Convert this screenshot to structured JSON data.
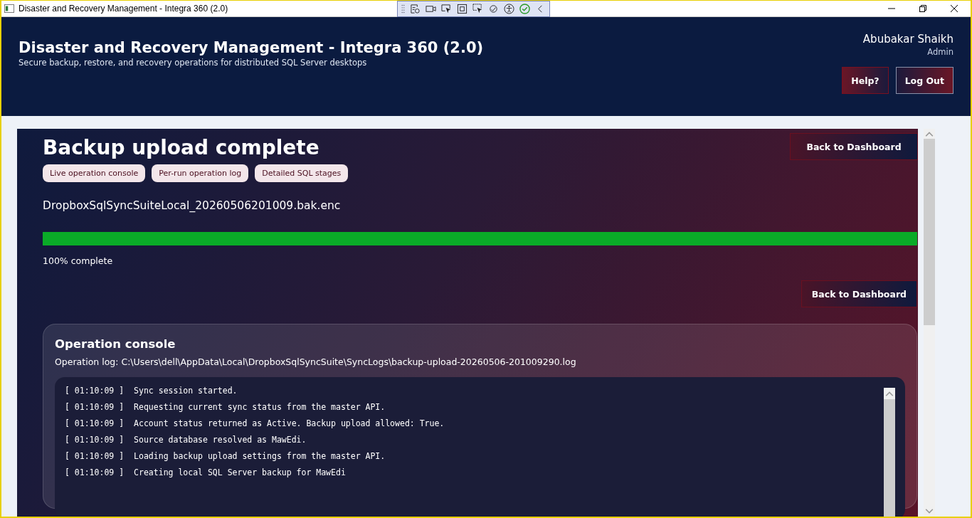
{
  "window": {
    "title": "Disaster and Recovery Management - Integra 360 (2.0)"
  },
  "header": {
    "title": "Disaster and Recovery Management - Integra 360 (2.0)",
    "subtitle": "Secure backup, restore, and recovery operations for distributed SQL Server desktops",
    "user_name": "Abubakar Shaikh",
    "user_role": "Admin",
    "buttons": [
      {
        "label": "Help?",
        "kind": "help"
      },
      {
        "label": "Log Out",
        "kind": "logout"
      }
    ]
  },
  "operation": {
    "title": "Backup upload complete",
    "back_button": "Back to Dashboard",
    "chips": [
      "Live operation console",
      "Per-run operation log",
      "Detailed SQL stages"
    ],
    "file_name": "DropboxSqlSyncSuiteLocal_20260506201009.bak.enc",
    "progress": {
      "level": 1.0,
      "reading": "100% complete"
    },
    "second_back_button": "Back to Dashboard"
  },
  "console": {
    "title": "Operation console",
    "log_path": "Operation log: C:\\Users\\dell\\AppData\\Local\\DropboxSqlSyncSuite\\SyncLogs\\backup-upload-20260506-201009290.log",
    "lines": [
      {
        "time": "[ 01:10:09 ]",
        "message": "Sync session started."
      },
      {
        "time": "[ 01:10:09 ]",
        "message": "Requesting current sync status from the master API."
      },
      {
        "time": "[ 01:10:09 ]",
        "message": "Account status returned as Active. Backup upload allowed: True."
      },
      {
        "time": "[ 01:10:09 ]",
        "message": "Source database resolved as MawEdi."
      },
      {
        "time": "[ 01:10:09 ]",
        "message": "Loading backup upload settings from the master API."
      },
      {
        "time": "[ 01:10:09 ]",
        "message": "Creating local SQL Server backup for MawEdi"
      }
    ]
  }
}
